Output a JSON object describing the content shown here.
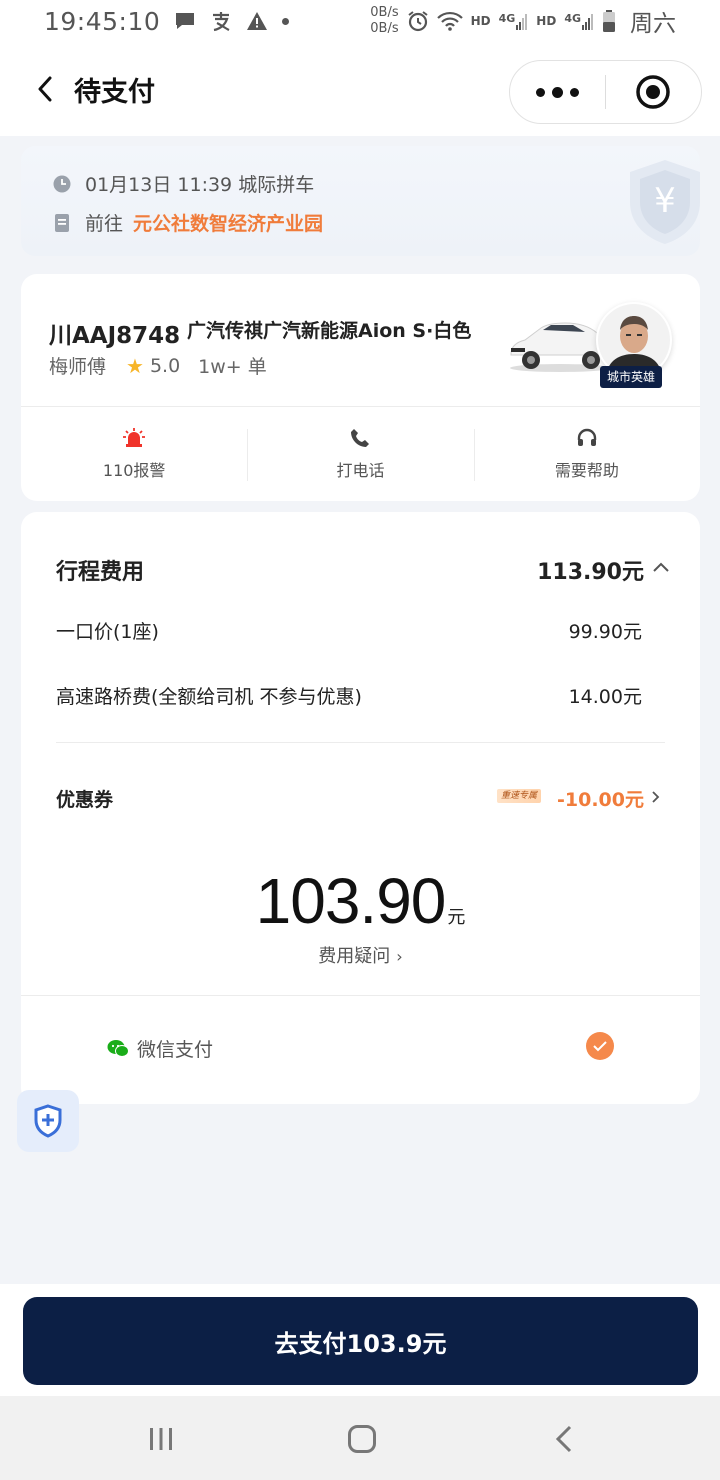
{
  "status_bar": {
    "time": "19:45:10",
    "net_up": "0B/s",
    "net_down": "0B/s",
    "hd1": "HD",
    "sig1": "4G",
    "hd2": "HD",
    "sig2": "4G",
    "weekday": "周六"
  },
  "nav": {
    "title": "待支付"
  },
  "trip": {
    "datetime": "01月13日 11:39 城际拼车",
    "to_prefix": "前往",
    "destination": "元公社数智经济产业园"
  },
  "driver": {
    "plate": "川AAJ8748",
    "car_model": "广汽传祺广汽新能源Aion S·白色",
    "name": "梅师傅",
    "rating": "5.0",
    "orders": "1w+ 单",
    "badge": "城市英雄"
  },
  "actions": [
    {
      "label": "110报警",
      "icon": "alarm-icon"
    },
    {
      "label": "打电话",
      "icon": "phone-icon"
    },
    {
      "label": "需要帮助",
      "icon": "headset-icon"
    }
  ],
  "fee": {
    "title": "行程费用",
    "total": "113.90元",
    "items": [
      {
        "label": "一口价(1座)",
        "value": "99.90元"
      },
      {
        "label": "高速路桥费(全额给司机 不参与优惠)",
        "value": "14.00元"
      }
    ],
    "coupon_label": "优惠券",
    "coupon_tag": "重速专属",
    "coupon_value": "-10.00元",
    "pay_amount": "103.90",
    "pay_unit": "元",
    "doubt_label": "费用疑问",
    "doubt_chevron": "›"
  },
  "payment": {
    "method": "微信支付",
    "selected": true
  },
  "bottom": {
    "pay_button": "去支付103.9元"
  },
  "colors": {
    "accent_orange": "#f07c3b",
    "button_navy": "#0c1f45",
    "wechat_green": "#1aad19"
  }
}
